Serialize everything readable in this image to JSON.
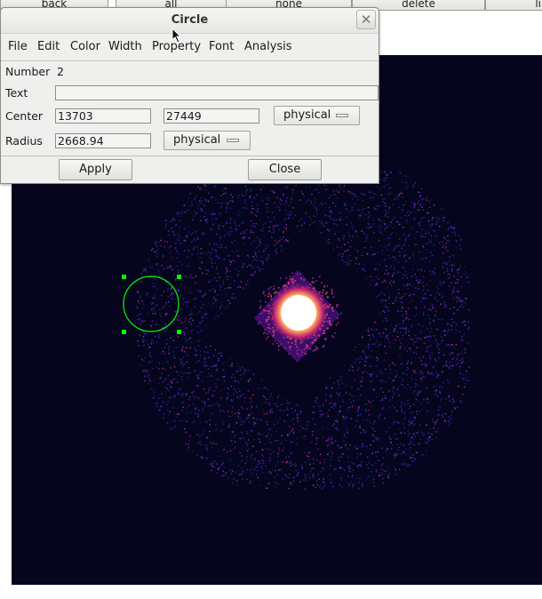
{
  "toolbar": {
    "buttons": [
      "back",
      "all",
      "none",
      "delete",
      "li"
    ]
  },
  "dialog": {
    "title": "Circle",
    "close_glyph": "✕",
    "menu": [
      "File",
      "Edit",
      "Color",
      "Width",
      "Property",
      "Font",
      "Analysis"
    ],
    "number_label": "Number",
    "number_value": "2",
    "text_label": "Text",
    "text_value": "",
    "center_label": "Center",
    "center_x": "13703",
    "center_y": "27449",
    "center_coord": "physical",
    "radius_label": "Radius",
    "radius_value": "2668.94",
    "radius_coord": "physical",
    "apply_label": "Apply",
    "close_label": "Close"
  },
  "colors": {
    "region": "#00ff00",
    "canvas_bg": "#05061d",
    "dialog_bg": "#efefed"
  }
}
